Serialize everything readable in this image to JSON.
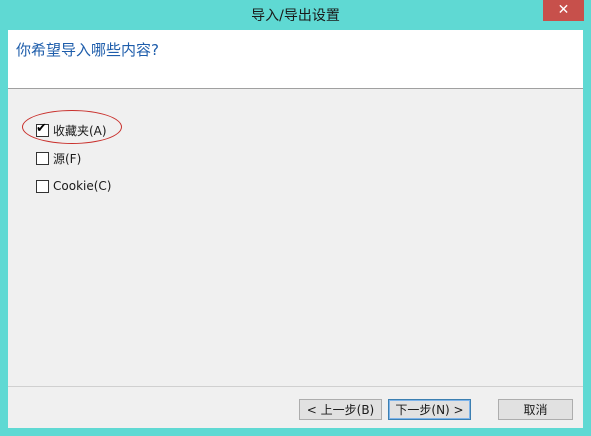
{
  "window": {
    "title": "导入/导出设置",
    "close_label": "✕"
  },
  "header": {
    "question": "你希望导入哪些内容?"
  },
  "options": [
    {
      "label": "收藏夹(A)",
      "checked": true
    },
    {
      "label": "源(F)",
      "checked": false
    },
    {
      "label": "Cookie(C)",
      "checked": false
    }
  ],
  "buttons": {
    "back": "< 上一步(B)",
    "next": "下一步(N) >",
    "cancel": "取消"
  },
  "checkmark": "✔",
  "colors": {
    "frame": "#5fd9d3",
    "question_text": "#1e5dab",
    "highlight_ellipse": "#c9302c",
    "close_button": "#c7504b"
  }
}
